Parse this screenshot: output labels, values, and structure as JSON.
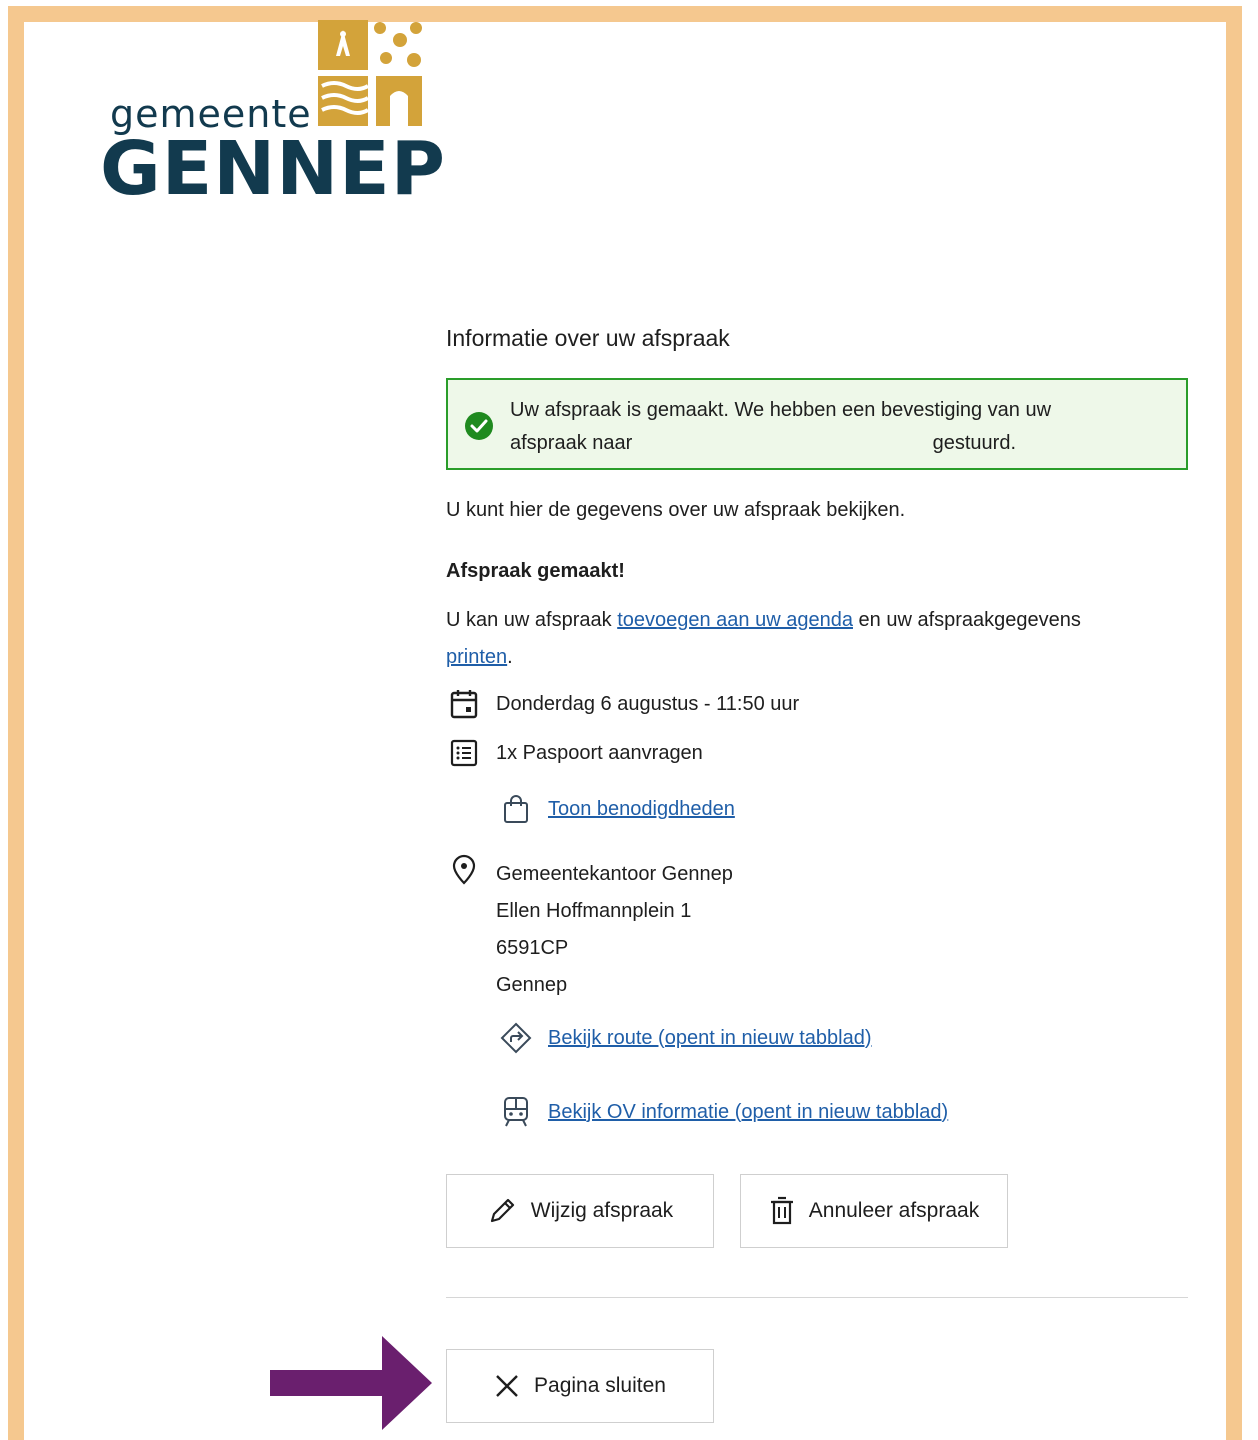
{
  "logo": {
    "small_text": "gemeente",
    "big_text": "GENNEP",
    "gold": "#d3a33a",
    "navy": "#123a4e"
  },
  "page": {
    "heading": "Informatie over uw afspraak",
    "alert": {
      "line1": "Uw afspraak is gemaakt. We hebben een bevestiging van uw",
      "line2_start": "afspraak naar",
      "line2_end": "gestuurd.",
      "icon": "check-circle-icon",
      "color": "#2a9d2a"
    },
    "intro": "U kunt hier de gegevens over uw afspraak bekijken.",
    "subheading": "Afspraak gemaakt!",
    "para": {
      "before": "U kan uw afspraak ",
      "link_agenda": "toevoegen aan uw agenda",
      "middle": " en uw afspraakgegevens",
      "link_print": "printen",
      "after": "."
    },
    "datetime": "Donderdag 6 augustus - 11:50 uur",
    "product": "1x Paspoort aanvragen",
    "requirements_link": "Toon benodigdheden",
    "location": {
      "name": "Gemeentekantoor Gennep",
      "street": "Ellen Hoffmannplein 1",
      "postcode": "6591CP",
      "city": "Gennep"
    },
    "route_link": "Bekijk route (opent in nieuw tabblad)",
    "ov_link": "Bekijk OV informatie (opent in nieuw tabblad)",
    "buttons": {
      "edit": "Wijzig afspraak",
      "cancel": "Annuleer afspraak",
      "close": "Pagina sluiten"
    },
    "link_color": "#1f5ea8"
  },
  "annotation": {
    "arrow_color": "#6a1f6e",
    "frame_color": "#f5c88f"
  }
}
